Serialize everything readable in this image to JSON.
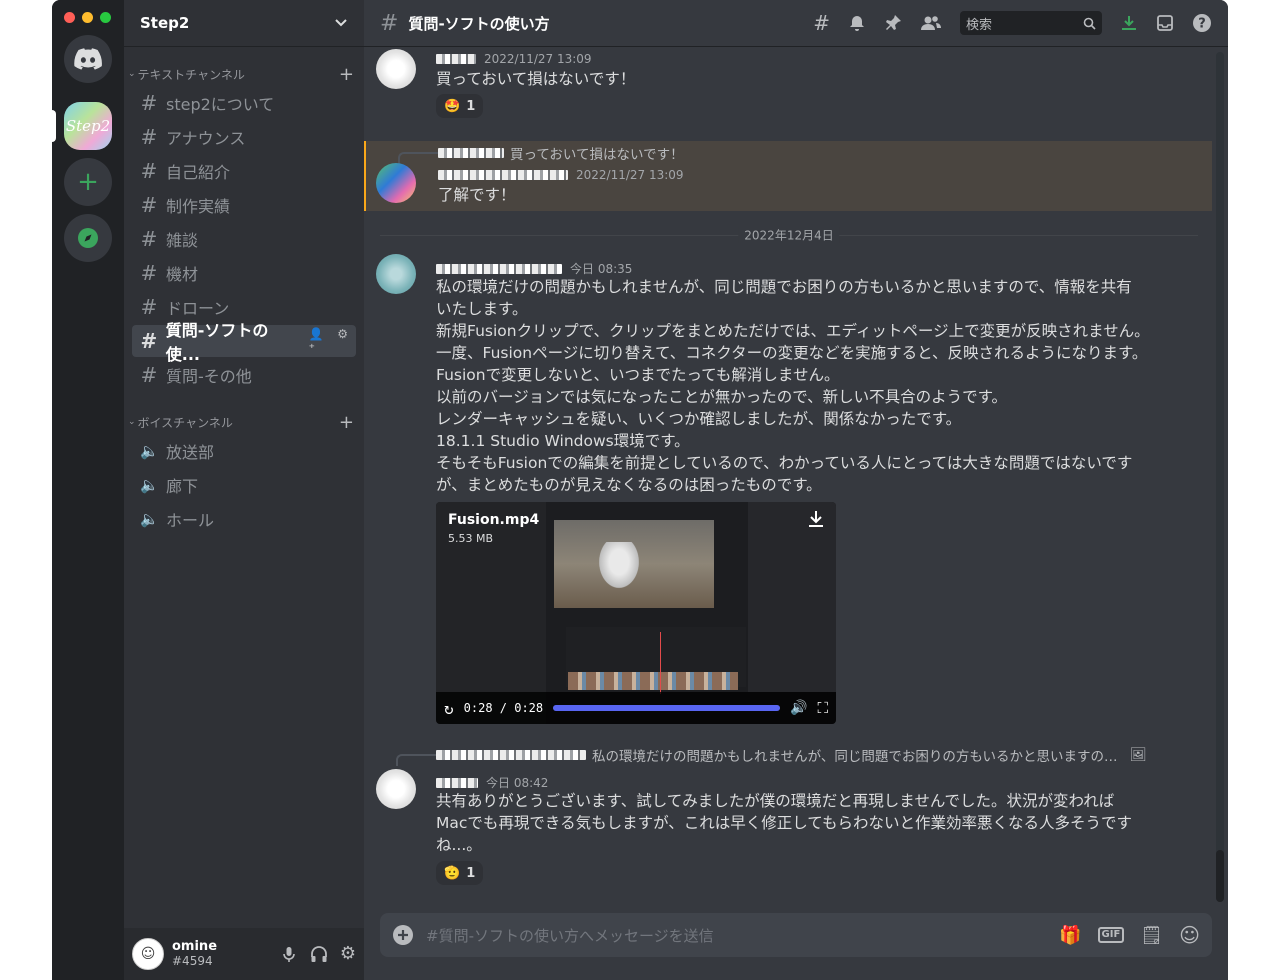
{
  "server": {
    "name": "Step2",
    "icon_text": "Step2"
  },
  "categories": {
    "text": "テキストチャンネル",
    "voice": "ボイスチャンネル"
  },
  "text_channels": [
    {
      "label": "step2について"
    },
    {
      "label": "アナウンス"
    },
    {
      "label": "自己紹介"
    },
    {
      "label": "制作実績"
    },
    {
      "label": "雑談"
    },
    {
      "label": "機材"
    },
    {
      "label": "ドローン"
    },
    {
      "label": "質問-ソフトの使..."
    },
    {
      "label": "質問-その他"
    }
  ],
  "voice_channels": [
    {
      "label": "放送部"
    },
    {
      "label": "廊下"
    },
    {
      "label": "ホール"
    }
  ],
  "user": {
    "name": "omine",
    "discriminator": "#4594"
  },
  "header": {
    "channel_title": "質問-ソフトの使い方",
    "search_placeholder": "検索"
  },
  "messages": [
    {
      "timestamp": "2022/11/27 13:09",
      "text": "買っておいて損はないです！",
      "reaction": {
        "emoji": "🤩",
        "count": "1"
      }
    },
    {
      "reply_text": "買っておいて損はないです！",
      "timestamp": "2022/11/27 13:09",
      "text": "了解です！"
    },
    {
      "date_divider": "2022年12月4日",
      "timestamp": "今日 08:35",
      "lines": [
        "私の環境だけの問題かもしれませんが、同じ問題でお困りの方もいるかと思いますので、情報を共有",
        "いたします。",
        "新規Fusionクリップで、クリップをまとめただけでは、エディットページ上で変更が反映されません。",
        "一度、Fusionページに切り替えて、コネクターの変更などを実施すると、反映されるようになります。",
        "Fusionで変更しないと、いつまでたっても解消しません。",
        "以前のバージョンでは気になったことが無かったので、新しい不具合のようです。",
        "レンダーキャッシュを疑い、いくつか確認しましたが、関係なかったです。",
        "18.1.1 Studio Windows環境です。",
        "そもそもFusionでの編集を前提としているので、わかっている人にとっては大きな問題ではないです",
        "が、まとめたものが見えなくなるのは困ったものです。"
      ],
      "attachment": {
        "filename": "Fusion.mp4",
        "size": "5.53 MB",
        "time": "0:28 / 0:28",
        "progress": 1.0
      }
    },
    {
      "reply_text": "私の環境だけの問題かもしれませんが、同じ問題でお困りの方もいるかと思いますの…",
      "timestamp": "今日 08:42",
      "lines": [
        "共有ありがとうございます、試してみましたが僕の環境だと再現しませんでした。状況が変われば",
        "Macでも再現できる気もしますが、これは早く修正してもらわないと作業効率悪くなる人多そうです",
        "ね...。"
      ],
      "reaction": {
        "emoji": "🫡",
        "count": "1"
      }
    }
  ],
  "composer": {
    "placeholder": "#質問-ソフトの使い方へメッセージを送信",
    "gif_label": "GIF"
  },
  "colors": {
    "accent": "#5865f2",
    "highlight_border": "#faa81a",
    "online_green": "#3ba55d"
  }
}
